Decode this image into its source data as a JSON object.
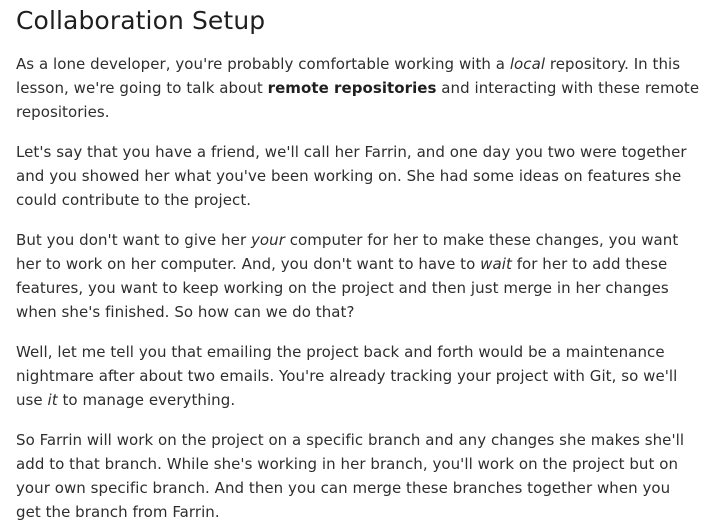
{
  "lesson": {
    "title": "Collaboration Setup",
    "p1": {
      "l1a": "As a lone developer, you're probably comfortable working with a ",
      "l1em": "local",
      "l1b": " repository. In this",
      "l2a": "lesson, we're going to talk about ",
      "l2strong": "remote repositories",
      "l2b": " and interacting with these remote",
      "l3": "repositories."
    },
    "p2": {
      "l1": "Let's say that you have a friend, we'll call her Farrin, and one day you two were together",
      "l2": "and you showed her what you've been working on. She had some ideas on features she",
      "l3": "could contribute to the project."
    },
    "p3": {
      "l1a": "But you don't want to give her ",
      "l1em": "your",
      "l1b": " computer for her to make these changes, you want",
      "l2a": "her to work on her computer. And, you don't want to have to ",
      "l2em": "wait",
      "l2b": " for her to add these",
      "l3": "features, you want to keep working on the project and then just merge in her changes",
      "l4": "when she's finished. So how can we do that?"
    },
    "p4": {
      "l1": "Well, let me tell you that emailing the project back and forth would be a maintenance",
      "l2": "nightmare after about two emails. You're already tracking your project with Git, so we'll",
      "l3a": "use ",
      "l3em": "it",
      "l3b": " to manage everything."
    },
    "p5": {
      "l1": "So Farrin will work on the project on a specific branch and any changes she makes she'll",
      "l2": "add to that branch. While she's working in her branch, you'll work on the project but on",
      "l3": "your own specific branch. And then you can merge these branches together when you",
      "l4": "get the branch from Farrin."
    }
  }
}
